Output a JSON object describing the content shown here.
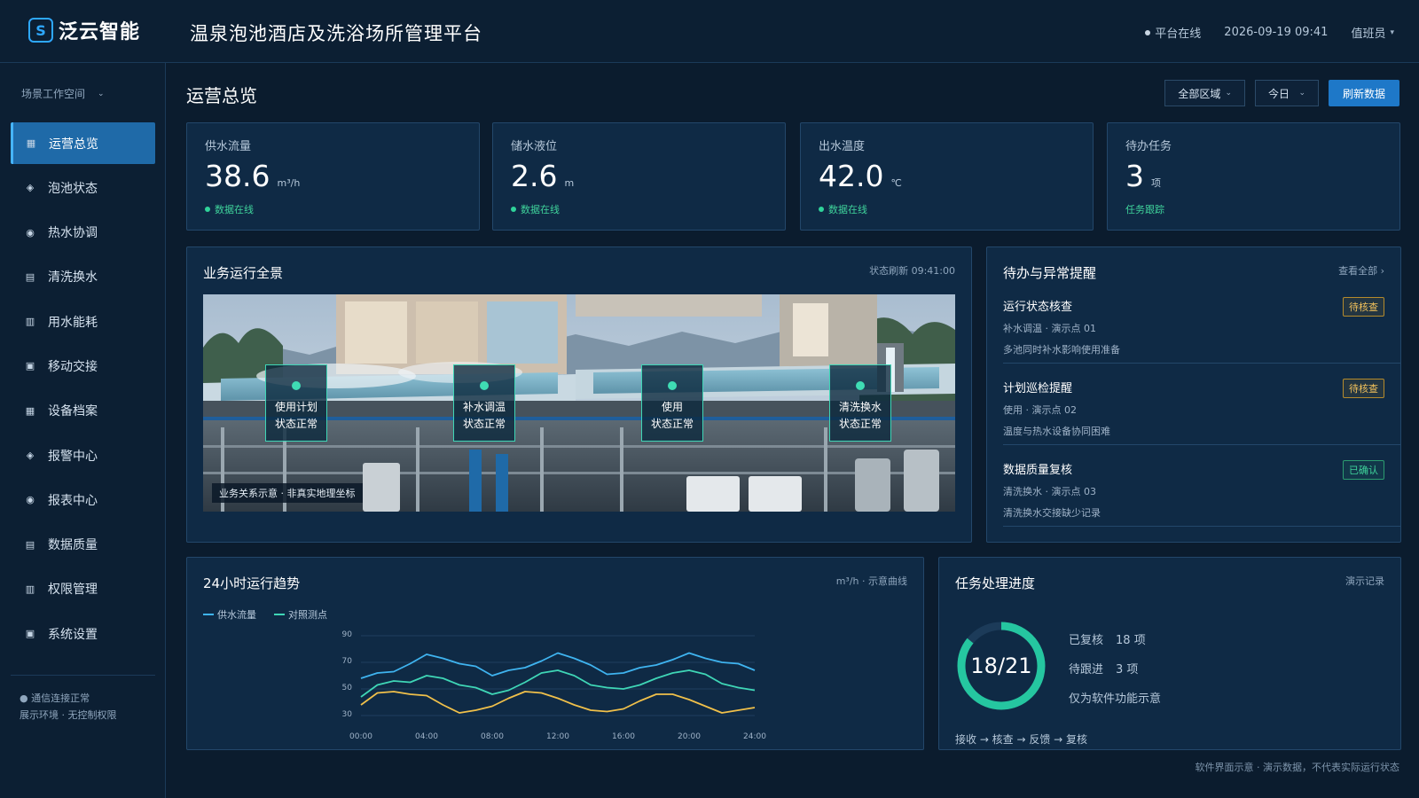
{
  "header": {
    "brand_mark": "S",
    "brand_name": "泛云智能",
    "title": "温泉泡池酒店及洗浴场所管理平台",
    "status": "平台在线",
    "datetime": "2026-09-19 09:41",
    "user": "值班员"
  },
  "sidebar": {
    "workspace": "场景工作空间",
    "items": [
      {
        "label": "运营总览",
        "icon": "grid-icon",
        "glyph": "▦",
        "active": true
      },
      {
        "label": "泡池状态",
        "icon": "diamond-icon",
        "glyph": "◈"
      },
      {
        "label": "热水协调",
        "icon": "radio-icon",
        "glyph": "◉"
      },
      {
        "label": "清洗换水",
        "icon": "list-icon",
        "glyph": "▤"
      },
      {
        "label": "用水能耗",
        "icon": "columns-icon",
        "glyph": "▥"
      },
      {
        "label": "移动交接",
        "icon": "square-icon",
        "glyph": "▣"
      },
      {
        "label": "设备档案",
        "icon": "grid-icon",
        "glyph": "▦"
      },
      {
        "label": "报警中心",
        "icon": "diamond-icon",
        "glyph": "◈"
      },
      {
        "label": "报表中心",
        "icon": "radio-icon",
        "glyph": "◉"
      },
      {
        "label": "数据质量",
        "icon": "list-icon",
        "glyph": "▤"
      },
      {
        "label": "权限管理",
        "icon": "columns-icon",
        "glyph": "▥"
      },
      {
        "label": "系统设置",
        "icon": "square-icon",
        "glyph": "▣"
      }
    ],
    "footer_status": "通信连接正常",
    "footer_env": "展示环境 · 无控制权限"
  },
  "main": {
    "title": "运营总览",
    "area_select": "全部区域",
    "period_select": "今日",
    "refresh": "刷新数据"
  },
  "stats": [
    {
      "label": "供水流量",
      "value": "38.6",
      "unit": "m³/h",
      "status": "数据在线",
      "has_dot": true
    },
    {
      "label": "储水液位",
      "value": "2.6",
      "unit": "m",
      "status": "数据在线",
      "has_dot": true
    },
    {
      "label": "出水温度",
      "value": "42.0",
      "unit": "℃",
      "status": "数据在线",
      "has_dot": true
    },
    {
      "label": "待办任务",
      "value": "3",
      "unit": "项",
      "status": "任务跟踪",
      "has_dot": false
    }
  ],
  "scene": {
    "title": "业务运行全景",
    "refresh_note": "状态刷新 09:41:00",
    "tag": "业务关系示意 · 非真实地理坐标",
    "hotspots": [
      {
        "name": "使用计划",
        "state": "状态正常"
      },
      {
        "name": "补水调温",
        "state": "状态正常"
      },
      {
        "name": "使用",
        "state": "状态正常"
      },
      {
        "name": "清洗换水",
        "state": "状态正常"
      }
    ]
  },
  "alerts": {
    "title": "待办与异常提醒",
    "view_all": "查看全部 ›",
    "items": [
      {
        "title": "运行状态核查",
        "meta": "补水调温 · 演示点 01",
        "desc": "多池同时补水影响使用准备",
        "badge": "待核查",
        "kind": "pending"
      },
      {
        "title": "计划巡检提醒",
        "meta": "使用 · 演示点 02",
        "desc": "温度与热水设备协同困难",
        "badge": "待核查",
        "kind": "pending"
      },
      {
        "title": "数据质量复核",
        "meta": "清洗换水 · 演示点 03",
        "desc": "清洗换水交接缺少记录",
        "badge": "已确认",
        "kind": "done"
      }
    ]
  },
  "trend": {
    "title": "24小时运行趋势",
    "unit_note": "m³/h · 示意曲线"
  },
  "chart_data": {
    "type": "line",
    "x": [
      "00:00",
      "01:00",
      "02:00",
      "03:00",
      "04:00",
      "05:00",
      "06:00",
      "07:00",
      "08:00",
      "09:00",
      "10:00",
      "11:00",
      "12:00",
      "13:00",
      "14:00",
      "15:00",
      "16:00",
      "17:00",
      "18:00",
      "19:00",
      "20:00",
      "21:00",
      "22:00",
      "23:00",
      "24:00"
    ],
    "x_ticks": [
      "00:00",
      "04:00",
      "08:00",
      "12:00",
      "16:00",
      "20:00",
      "24:00"
    ],
    "y_ticks": [
      90,
      70,
      50,
      30
    ],
    "ylim": [
      30,
      90
    ],
    "grid": true,
    "legend_position": "top-left",
    "series": [
      {
        "name": "供水流量",
        "color": "#3fb4f0",
        "values": [
          58,
          62,
          63,
          69,
          76,
          73,
          69,
          67,
          60,
          64,
          66,
          71,
          77,
          73,
          68,
          61,
          62,
          66,
          68,
          72,
          77,
          73,
          70,
          69,
          64
        ]
      },
      {
        "name": "对照测点",
        "color": "#3fd6b6",
        "values": [
          44,
          53,
          56,
          55,
          60,
          58,
          53,
          51,
          46,
          49,
          55,
          62,
          64,
          60,
          53,
          51,
          50,
          53,
          58,
          62,
          64,
          61,
          54,
          51,
          49
        ]
      },
      {
        "name": "",
        "color": "#f0c04a",
        "values": [
          38,
          47,
          48,
          46,
          45,
          38,
          32,
          34,
          37,
          43,
          48,
          47,
          43,
          38,
          34,
          33,
          35,
          41,
          46,
          46,
          42,
          37,
          32,
          34,
          36
        ]
      }
    ]
  },
  "progress": {
    "title": "任务处理进度",
    "note": "演示记录",
    "ratio_text": "18/21",
    "done": 18,
    "total": 21,
    "reviewed_label": "已复核",
    "reviewed_value": "18 项",
    "followup_label": "待跟进",
    "followup_value": "3 项",
    "demo_note": "仅为软件功能示意",
    "flow": "接收 → 核查 → 反馈 → 复核",
    "ring_color": "#25c6a0"
  },
  "footnote": "软件界面示意 · 演示数据，不代表实际运行状态"
}
